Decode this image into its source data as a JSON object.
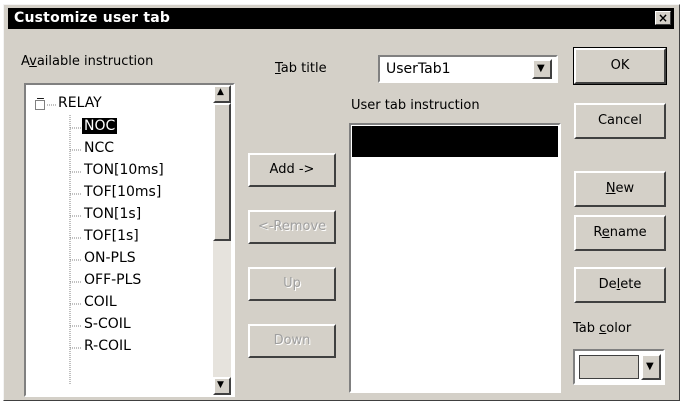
{
  "window": {
    "title": "Customize user tab",
    "close_glyph": "×"
  },
  "available": {
    "label_pre": "A",
    "label_key": "v",
    "label_post": "ailable instruction",
    "root": "RELAY",
    "root_toggle": "−",
    "items": [
      "NOC",
      "NCC",
      "TON[10ms]",
      "TOF[10ms]",
      "TON[1s]",
      "TOF[1s]",
      "ON-PLS",
      "OFF-PLS",
      "COIL",
      "S-COIL",
      "R-COIL"
    ],
    "selected_index": 0
  },
  "tab_title": {
    "label_key": "T",
    "label_post": "ab title",
    "value": "UserTab1",
    "dropdown_glyph": "▼"
  },
  "user_tab": {
    "label": "User tab instruction"
  },
  "buttons": {
    "add": "Add ->",
    "remove": "<-Remove",
    "up": "Up",
    "down": "Down",
    "ok": "OK",
    "cancel": "Cancel",
    "new_pre": "",
    "new_key": "N",
    "new_post": "ew",
    "rename_pre": "R",
    "rename_key": "e",
    "rename_post": "name",
    "delete_pre": "De",
    "delete_key": "l",
    "delete_post": "ete"
  },
  "tab_color": {
    "label_pre": "Tab ",
    "label_key": "c",
    "label_post": "olor",
    "value": "#d4d0c8",
    "dropdown_glyph": "▼"
  },
  "scroll": {
    "up_glyph": "▲",
    "down_glyph": "▼"
  }
}
